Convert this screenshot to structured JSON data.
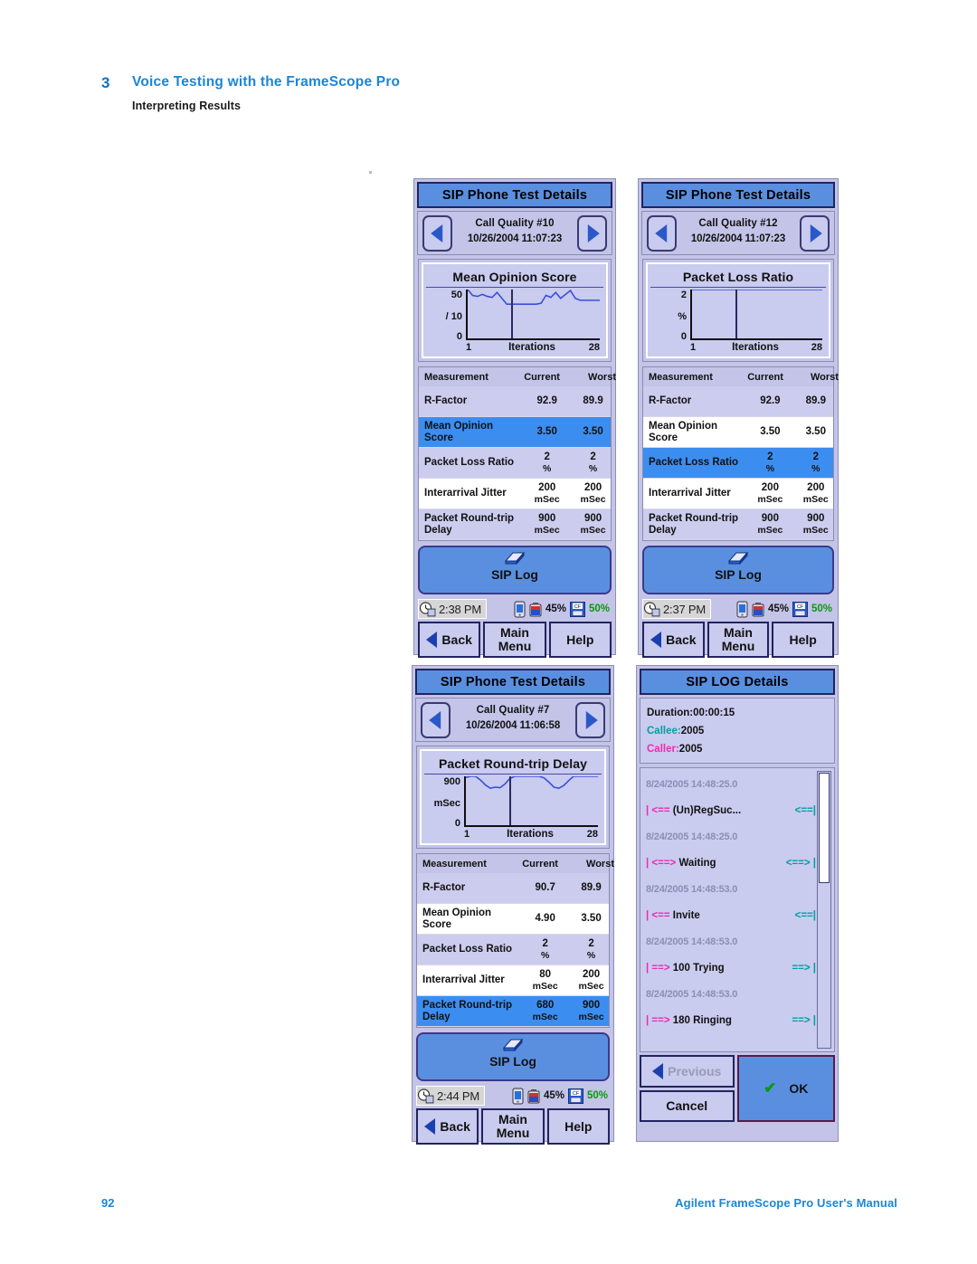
{
  "page": {
    "chapter_number": "3",
    "chapter_title": "Voice Testing with the FrameScope Pro",
    "section_title": "Interpreting Results",
    "page_number": "92",
    "footer_text": "Agilent FrameScope Pro User's Manual"
  },
  "common": {
    "table_headers": {
      "measurement": "Measurement",
      "current": "Current",
      "worst": "Worst"
    },
    "siplog_label": "SIP Log",
    "buttons": {
      "back": "Back",
      "main_menu_1": "Main",
      "main_menu_2": "Menu",
      "help": "Help"
    },
    "chart_axis": {
      "x_start": "1",
      "x_label": "Iterations",
      "x_end": "28"
    },
    "colors": {
      "header_blue": "#5a8fe0",
      "panel_lavender": "#c3c4e8",
      "row_selected": "#3c8df0",
      "row_alt": "#ccccee",
      "accent_link": "#1a86d8",
      "green": "#0a9a0a",
      "teal": "#00a0a0",
      "magenta": "#ef2bb0"
    }
  },
  "panels": [
    {
      "id": "panel-mos",
      "title": "SIP Phone Test Details",
      "nav": {
        "line1": "Call Quality #10",
        "line2": "10/26/2004 11:07:23"
      },
      "chart": {
        "title": "Mean Opinion Score",
        "y_max": "50",
        "y_unit": "/ 10",
        "y_min": "0"
      },
      "rows": [
        {
          "name": "R-Factor",
          "current": "92.9",
          "worst": "89.9",
          "unit": "",
          "selected": false
        },
        {
          "name": "Mean Opinion Score",
          "current": "3.50",
          "worst": "3.50",
          "unit": "",
          "selected": true
        },
        {
          "name": "Packet Loss Ratio",
          "current": "2",
          "worst": "2",
          "unit": "%",
          "selected": false
        },
        {
          "name": "Interarrival Jitter",
          "current": "200",
          "worst": "200",
          "unit": "mSec",
          "selected": false
        },
        {
          "name": "Packet Round-trip Delay",
          "current": "900",
          "worst": "900",
          "unit": "mSec",
          "selected": false
        }
      ],
      "status": {
        "time": "2:38 PM",
        "battery": "45%",
        "storage": "50%"
      }
    },
    {
      "id": "panel-plr",
      "title": "SIP Phone Test Details",
      "nav": {
        "line1": "Call Quality #12",
        "line2": "10/26/2004 11:07:23"
      },
      "chart": {
        "title": "Packet Loss Ratio",
        "y_max": "2",
        "y_unit": "%",
        "y_min": "0"
      },
      "rows": [
        {
          "name": "R-Factor",
          "current": "92.9",
          "worst": "89.9",
          "unit": "",
          "selected": false
        },
        {
          "name": "Mean Opinion Score",
          "current": "3.50",
          "worst": "3.50",
          "unit": "",
          "selected": false
        },
        {
          "name": "Packet Loss Ratio",
          "current": "2",
          "worst": "2",
          "unit": "%",
          "selected": true
        },
        {
          "name": "Interarrival Jitter",
          "current": "200",
          "worst": "200",
          "unit": "mSec",
          "selected": false
        },
        {
          "name": "Packet Round-trip Delay",
          "current": "900",
          "worst": "900",
          "unit": "mSec",
          "selected": false
        }
      ],
      "status": {
        "time": "2:37 PM",
        "battery": "45%",
        "storage": "50%"
      }
    },
    {
      "id": "panel-rtd",
      "title": "SIP Phone Test Details",
      "nav": {
        "line1": "Call Quality #7",
        "line2": "10/26/2004 11:06:58"
      },
      "chart": {
        "title": "Packet Round-trip Delay",
        "y_max": "900",
        "y_unit": "mSec",
        "y_min": "0"
      },
      "rows": [
        {
          "name": "R-Factor",
          "current": "90.7",
          "worst": "89.9",
          "unit": "",
          "selected": false
        },
        {
          "name": "Mean Opinion Score",
          "current": "4.90",
          "worst": "3.50",
          "unit": "",
          "selected": false
        },
        {
          "name": "Packet Loss Ratio",
          "current": "2",
          "worst": "2",
          "unit": "%",
          "selected": false
        },
        {
          "name": "Interarrival Jitter",
          "current": "80",
          "worst": "200",
          "unit": "mSec",
          "selected": false
        },
        {
          "name": "Packet Round-trip Delay",
          "current": "680",
          "worst": "900",
          "unit": "mSec",
          "selected": true
        }
      ],
      "status": {
        "time": "2:44 PM",
        "battery": "45%",
        "storage": "50%"
      }
    }
  ],
  "log_panel": {
    "title": "SIP LOG Details",
    "info": {
      "duration_label": "Duration:",
      "duration_value": "00:00:15",
      "callee_label": "Callee:",
      "callee_value": "2005",
      "caller_label": "Caller:",
      "caller_value": "2005"
    },
    "entries": [
      {
        "timestamp": "8/24/2005 14:48:25.0",
        "arrow_left": "| <==",
        "message": "(Un)RegSuc...",
        "arrow_right": "<==|"
      },
      {
        "timestamp": "8/24/2005 14:48:25.0",
        "arrow_left": "| <==>",
        "message": "Waiting",
        "arrow_right": "<==> |"
      },
      {
        "timestamp": "8/24/2005 14:48:53.0",
        "arrow_left": "| <==",
        "message": "Invite",
        "arrow_right": "<==|"
      },
      {
        "timestamp": "8/24/2005 14:48:53.0",
        "arrow_left": "| ==>",
        "message": "100 Trying",
        "arrow_right": "==> |"
      },
      {
        "timestamp": "8/24/2005 14:48:53.0",
        "arrow_left": "| ==>",
        "message": "180 Ringing",
        "arrow_right": "==> |"
      }
    ],
    "buttons": {
      "previous": "Previous",
      "cancel": "Cancel",
      "ok": "OK"
    }
  },
  "chart_data": [
    {
      "type": "line",
      "title": "Mean Opinion Score",
      "xlabel": "Iterations",
      "ylabel": "/ 10",
      "xlim": [
        1,
        28
      ],
      "ylim": [
        0,
        50
      ],
      "yticks": [
        "0",
        "50"
      ],
      "grid": false,
      "series": [
        {
          "name": "Mean Opinion Score",
          "values": [
            50,
            44,
            43,
            45,
            43,
            42,
            47,
            41,
            35,
            35,
            35,
            35,
            35,
            35,
            35,
            36,
            44,
            42,
            47,
            41,
            45,
            49,
            41,
            39,
            39,
            39,
            39,
            39
          ]
        }
      ]
    },
    {
      "type": "line",
      "title": "Packet Loss Ratio",
      "xlabel": "Iterations",
      "ylabel": "%",
      "xlim": [
        1,
        28
      ],
      "ylim": [
        0,
        2
      ],
      "yticks": [
        "0",
        "2"
      ],
      "grid": false,
      "series": [
        {
          "name": "Packet Loss Ratio",
          "values": [
            2,
            2,
            2,
            2,
            2,
            2,
            2,
            2,
            2,
            2,
            2,
            2,
            2,
            2,
            2,
            2,
            2,
            2,
            2,
            2,
            2,
            2,
            2,
            2,
            2,
            2,
            2,
            2
          ]
        }
      ]
    },
    {
      "type": "line",
      "title": "Packet Round-trip Delay",
      "xlabel": "Iterations",
      "ylabel": "mSec",
      "xlim": [
        1,
        28
      ],
      "ylim": [
        0,
        900
      ],
      "yticks": [
        "0",
        "900"
      ],
      "grid": false,
      "series": [
        {
          "name": "Packet Round-trip Delay",
          "values": [
            880,
            900,
            900,
            830,
            740,
            680,
            700,
            690,
            760,
            860,
            900,
            900,
            900,
            900,
            900,
            900,
            870,
            790,
            700,
            680,
            730,
            820,
            900,
            900,
            900,
            900,
            900,
            900
          ]
        }
      ]
    }
  ]
}
